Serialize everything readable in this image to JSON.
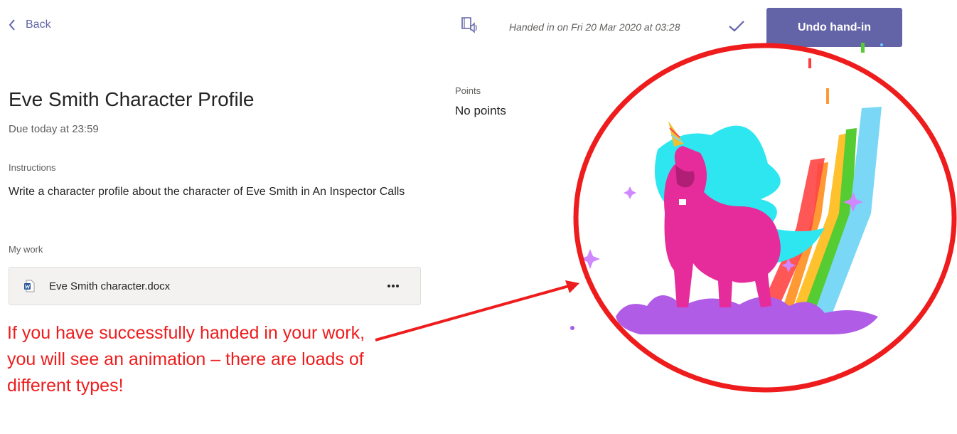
{
  "nav": {
    "back_label": "Back"
  },
  "assignment": {
    "title": "Eve Smith Character Profile",
    "due": "Due today at 23:59",
    "instructions_label": "Instructions",
    "instructions_text": "Write a character profile about the character of Eve Smith in An Inspector Calls",
    "my_work_label": "My work",
    "attachment": {
      "file_name": "Eve Smith character.docx",
      "file_icon": "word-doc-icon",
      "more_icon": "more-options-icon"
    }
  },
  "points": {
    "label": "Points",
    "value": "No points"
  },
  "header": {
    "reader_icon": "immersive-reader-icon",
    "status_text": "Handed in on Fri 20 Mar 2020 at 03:28",
    "status_icon": "checkmark-icon",
    "undo_label": "Undo hand-in"
  },
  "annotation": {
    "text": "If you have successfully handed in your work, you will see an animation – there are loads of different types!",
    "color": "#ee1c1c"
  },
  "colors": {
    "accent": "#6264a7",
    "annotation_red": "#ee1c1c"
  }
}
